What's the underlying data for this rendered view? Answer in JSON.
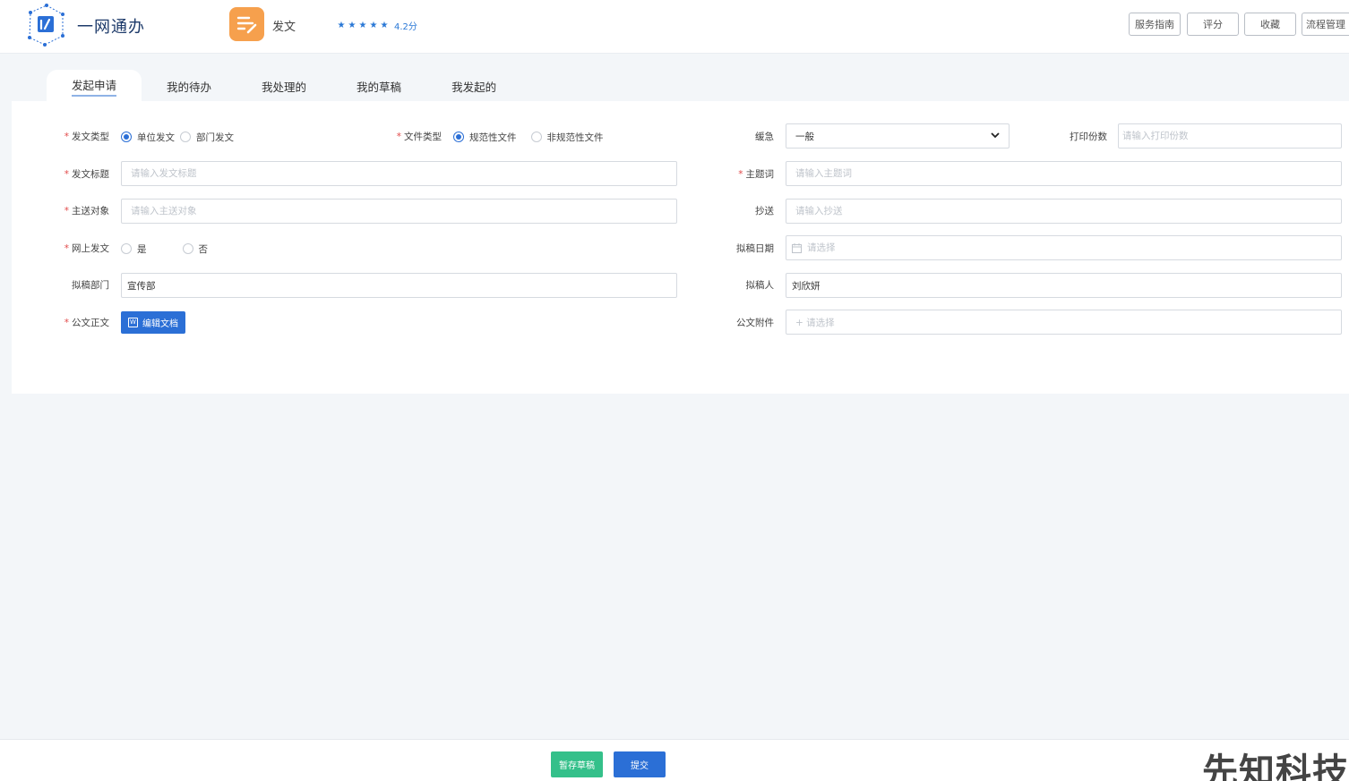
{
  "header": {
    "brand": "一网通办",
    "app_name": "发文",
    "rating_value": 4.2,
    "rating_text": "4.2分",
    "buttons": {
      "guide": "服务指南",
      "rate": "评分",
      "favorite": "收藏",
      "process": "流程管理"
    }
  },
  "tabs": [
    {
      "label": "发起申请",
      "active": true
    },
    {
      "label": "我的待办",
      "active": false
    },
    {
      "label": "我处理的",
      "active": false
    },
    {
      "label": "我的草稿",
      "active": false
    },
    {
      "label": "我发起的",
      "active": false
    }
  ],
  "form": {
    "doc_type": {
      "label": "发文类型",
      "options": [
        "单位发文",
        "部门发文"
      ],
      "selected": "单位发文"
    },
    "file_type": {
      "label": "文件类型",
      "options": [
        "规范性文件",
        "非规范性文件"
      ],
      "selected": "规范性文件"
    },
    "urgency": {
      "label": "缓急",
      "value": "一般"
    },
    "print_copies": {
      "label": "打印份数",
      "placeholder": "请输入打印份数"
    },
    "title": {
      "label": "发文标题",
      "placeholder": "请输入发文标题"
    },
    "keywords": {
      "label": "主题词",
      "placeholder": "请输入主题词"
    },
    "recipient": {
      "label": "主送对象",
      "placeholder": "请输入主送对象"
    },
    "cc": {
      "label": "抄送",
      "placeholder": "请输入抄送"
    },
    "online": {
      "label": "网上发文",
      "options": [
        "是",
        "否"
      ],
      "selected": ""
    },
    "draft_date": {
      "label": "拟稿日期",
      "placeholder": "请选择"
    },
    "draft_dept": {
      "label": "拟稿部门",
      "value": "宣传部"
    },
    "drafter": {
      "label": "拟稿人",
      "value": "刘欣妍"
    },
    "body": {
      "label": "公文正文",
      "button": "编辑文档"
    },
    "attachment": {
      "label": "公文附件",
      "placeholder": "+ 请选择"
    }
  },
  "footer": {
    "draft_button": "暂存草稿",
    "submit_button": "提交",
    "watermark": "先知科技"
  },
  "colors": {
    "primary": "#2b6fd6",
    "success": "#34c08a",
    "app_icon": "#f6a04d",
    "required": "#e24a4a"
  }
}
